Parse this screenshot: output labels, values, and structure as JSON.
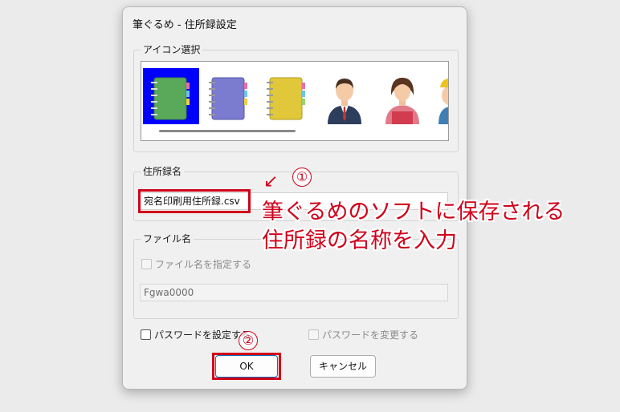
{
  "dialog": {
    "title": "筆ぐるめ - 住所録設定"
  },
  "icon_group": {
    "label": "アイコン選択",
    "icons": [
      {
        "name": "green-notebook-icon",
        "color": "#5aa85a",
        "selected": true
      },
      {
        "name": "purple-notebook-icon",
        "color": "#7b7bd0",
        "selected": false
      },
      {
        "name": "yellow-notebook-icon",
        "color": "#e0c83a",
        "selected": false
      },
      {
        "name": "man-avatar-icon",
        "selected": false
      },
      {
        "name": "woman-avatar-icon",
        "selected": false
      },
      {
        "name": "worker-avatar-icon",
        "selected": false
      }
    ],
    "selected_color": "#0000ff"
  },
  "address_book": {
    "label": "住所録名",
    "value": "宛名印刷用住所録.csv"
  },
  "file_group": {
    "label": "ファイル名",
    "checkbox_label": "ファイル名を指定する",
    "value": "Fgwa0000"
  },
  "password": {
    "set_label": "パスワードを設定する",
    "change_label": "パスワードを変更する"
  },
  "buttons": {
    "ok": "OK",
    "cancel": "キャンセル"
  },
  "annotations": {
    "step1": "①",
    "step2": "②",
    "arrow": "↙",
    "line1": "筆ぐるめのソフトに保存される",
    "line2": "住所録の名称を入力",
    "accent_color": "#d0021b"
  }
}
